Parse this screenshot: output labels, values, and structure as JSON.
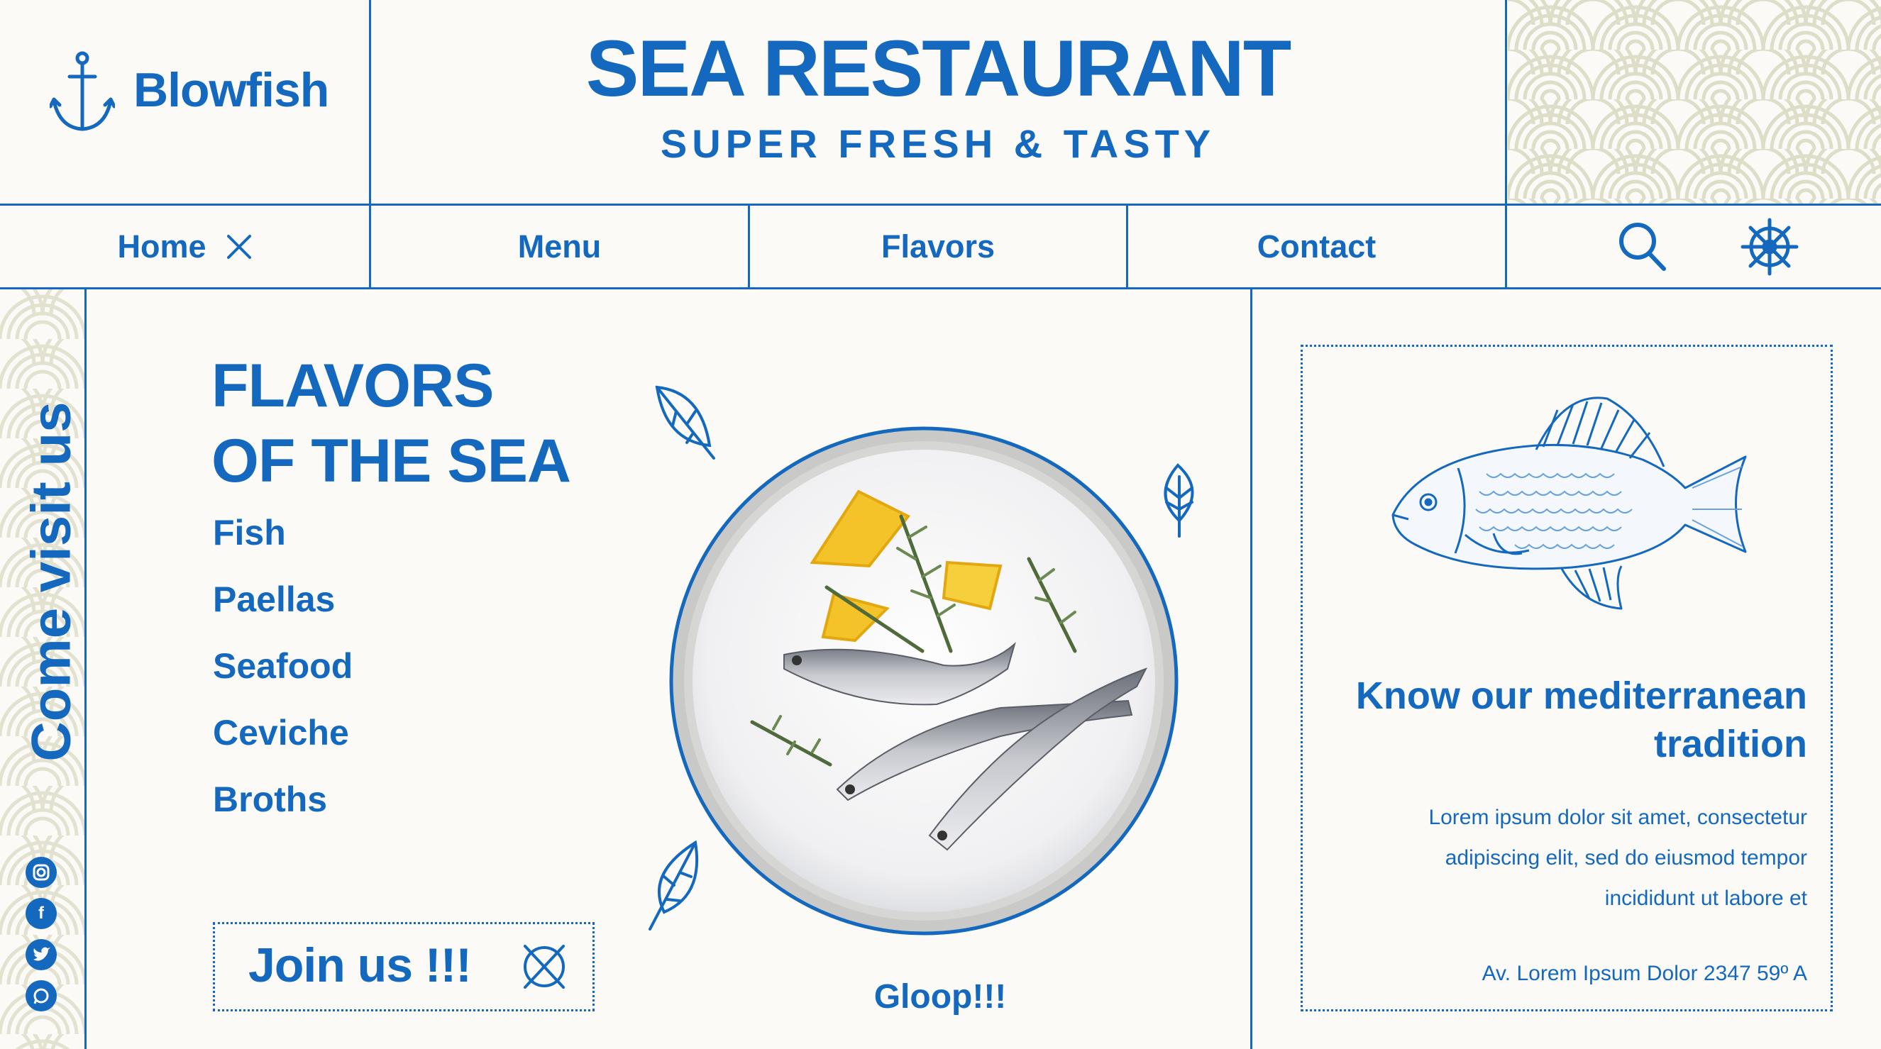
{
  "brand": {
    "name": "Blowfish",
    "logo_icon": "anchor-icon"
  },
  "header": {
    "title": "SEA RESTAURANT",
    "subtitle": "SUPER FRESH & TASTY"
  },
  "nav": {
    "items": [
      {
        "label": "Home",
        "icon": "close-icon"
      },
      {
        "label": "Menu"
      },
      {
        "label": "Flavors"
      },
      {
        "label": "Contact"
      }
    ],
    "search_icon": "search-icon",
    "ship_wheel_icon": "ship-wheel-icon"
  },
  "sidebar": {
    "text": "Come visit us",
    "social_icons": [
      "instagram-icon",
      "facebook-icon",
      "twitter-icon",
      "whatsapp-icon"
    ]
  },
  "main": {
    "heading_lines": [
      "FLAVORS",
      "OF THE SEA"
    ],
    "categories": [
      "Fish",
      "Paellas",
      "Seafood",
      "Ceviche",
      "Broths"
    ],
    "join_label": "Join us !!!",
    "gloop": "Gloop!!!",
    "plate_image": "plate-of-fish-image"
  },
  "card": {
    "title": "Know our mediterranean tradition",
    "text_lines": [
      "Lorem ipsum dolor sit amet, consectetur",
      "adipiscing elit, sed do eiusmod tempor",
      "incididunt ut labore et"
    ],
    "address": "Av. Lorem Ipsum Dolor 2347 59º A",
    "illustration": "fish-illustration"
  },
  "colors": {
    "primary": "#1469bf",
    "background": "#fbfaf6",
    "pattern": "#ddddc8"
  }
}
